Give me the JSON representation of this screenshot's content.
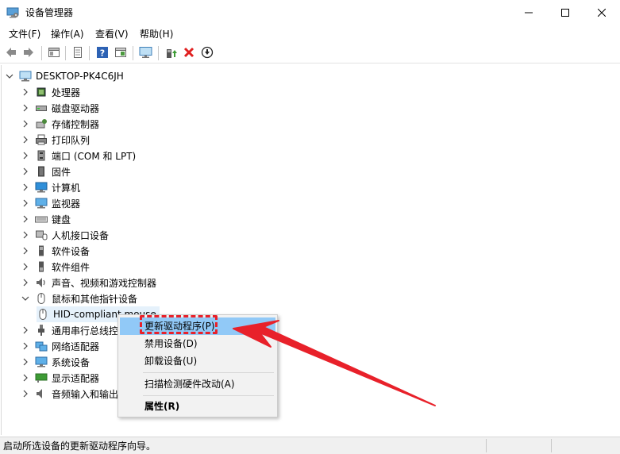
{
  "window": {
    "title": "设备管理器",
    "icons": {
      "app": "device-manager-icon",
      "minimize": "minimize-icon",
      "maximize": "maximize-icon",
      "close": "close-icon"
    }
  },
  "menu": {
    "file": "文件(F)",
    "action": "操作(A)",
    "view": "查看(V)",
    "help": "帮助(H)"
  },
  "toolbar": {
    "icons": [
      "back-icon",
      "forward-icon",
      "properties-pane-icon",
      "print-icon",
      "help-icon",
      "view-icon",
      "monitor-icon",
      "update-driver-icon",
      "uninstall-icon",
      "download-icon"
    ]
  },
  "tree": {
    "root": "DESKTOP-PK4C6JH",
    "categories": [
      {
        "label": "处理器",
        "icon": "processor-icon"
      },
      {
        "label": "磁盘驱动器",
        "icon": "disk-drive-icon"
      },
      {
        "label": "存储控制器",
        "icon": "storage-controller-icon"
      },
      {
        "label": "打印队列",
        "icon": "printer-icon"
      },
      {
        "label": "端口 (COM 和 LPT)",
        "icon": "port-icon"
      },
      {
        "label": "固件",
        "icon": "firmware-icon"
      },
      {
        "label": "计算机",
        "icon": "computer-icon"
      },
      {
        "label": "监视器",
        "icon": "monitor-icon"
      },
      {
        "label": "键盘",
        "icon": "keyboard-icon"
      },
      {
        "label": "人机接口设备",
        "icon": "hid-icon"
      },
      {
        "label": "软件设备",
        "icon": "software-device-icon"
      },
      {
        "label": "软件组件",
        "icon": "software-component-icon"
      },
      {
        "label": "声音、视频和游戏控制器",
        "icon": "sound-icon"
      },
      {
        "label": "鼠标和其他指针设备",
        "icon": "mouse-icon"
      }
    ],
    "child": "HID-compliant mouse",
    "after": [
      {
        "label": "通用串行总线控制器",
        "icon": "usb-icon"
      },
      {
        "label": "网络适配器",
        "icon": "network-adapter-icon"
      },
      {
        "label": "系统设备",
        "icon": "system-device-icon"
      },
      {
        "label": "显示适配器",
        "icon": "display-adapter-icon"
      },
      {
        "label": "音频输入和输出",
        "icon": "audio-io-icon"
      }
    ]
  },
  "context_menu": {
    "update_driver": "更新驱动程序(P)",
    "disable_device": "禁用设备(D)",
    "uninstall_device": "卸载设备(U)",
    "scan_hardware": "扫描检测硬件改动(A)",
    "properties": "属性(R)"
  },
  "status": {
    "text": "启动所选设备的更新驱动程序向导。"
  },
  "colors": {
    "highlight": "#91c9f7",
    "annotation_red": "#e8212a",
    "menu_background": "#f2f2f2",
    "statusbar_background": "#f0f0f0"
  }
}
